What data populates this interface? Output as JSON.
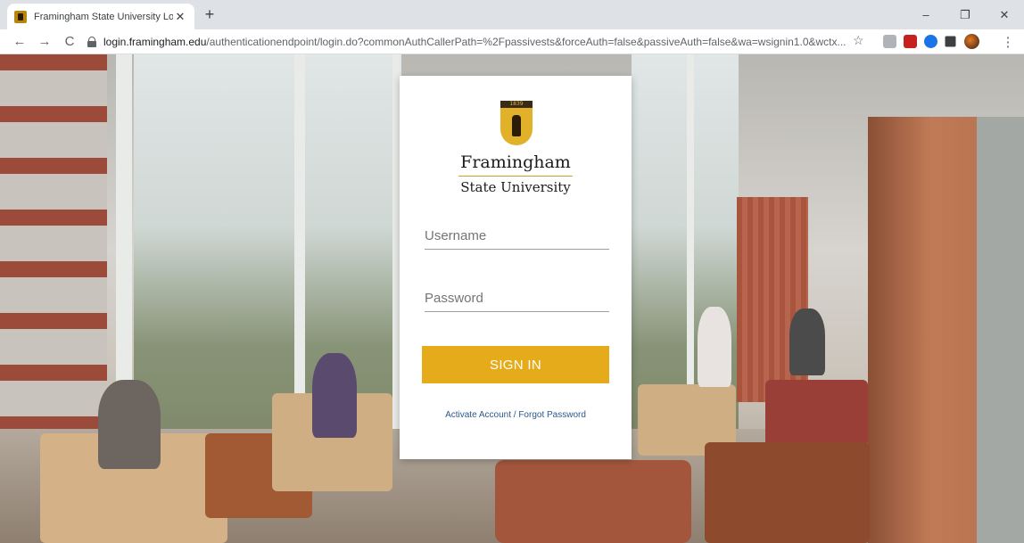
{
  "browser": {
    "tab_title": "Framingham State University Log",
    "tab_close": "✕",
    "new_tab": "+",
    "controls": {
      "minimize": "–",
      "restore": "❐",
      "close": "✕"
    },
    "nav": {
      "back": "←",
      "forward": "→",
      "reload": "C"
    },
    "url_host": "login.framingham.edu",
    "url_path": "/authenticationendpoint/login.do?commonAuthCallerPath=%2Fpassivests&forceAuth=false&passiveAuth=false&wa=wsignin1.0&wctx...",
    "star": "☆",
    "menu": "⋮"
  },
  "login": {
    "seal_year": "1839",
    "logo_line1": "Framingham",
    "logo_line2": "State University",
    "username_placeholder": "Username",
    "password_placeholder": "Password",
    "signin_label": "SIGN IN",
    "forgot_link": "Activate Account / Forgot Password"
  },
  "colors": {
    "accent": "#e6ab1a",
    "link": "#2b5a8c"
  }
}
